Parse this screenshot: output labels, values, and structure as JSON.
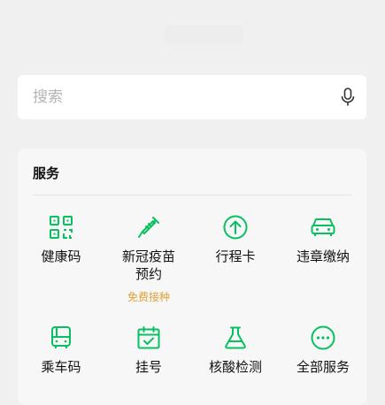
{
  "search": {
    "placeholder": "搜索",
    "mic_icon": "microphone-icon"
  },
  "services": {
    "title": "服务",
    "items": [
      {
        "label": "健康码",
        "icon": "qr-code-icon"
      },
      {
        "label": "新冠疫苗\n预约",
        "icon": "syringe-icon",
        "sub": "免费接种"
      },
      {
        "label": "行程卡",
        "icon": "arrow-up-circle-icon"
      },
      {
        "label": "违章缴纳",
        "icon": "car-icon"
      },
      {
        "label": "乘车码",
        "icon": "bus-icon"
      },
      {
        "label": "挂号",
        "icon": "calendar-check-icon"
      },
      {
        "label": "核酸检测",
        "icon": "flask-icon"
      },
      {
        "label": "全部服务",
        "icon": "more-circle-icon"
      }
    ]
  },
  "colors": {
    "accent": "#07c160",
    "highlight": "#e0a238",
    "background": "#f0f0f0"
  }
}
